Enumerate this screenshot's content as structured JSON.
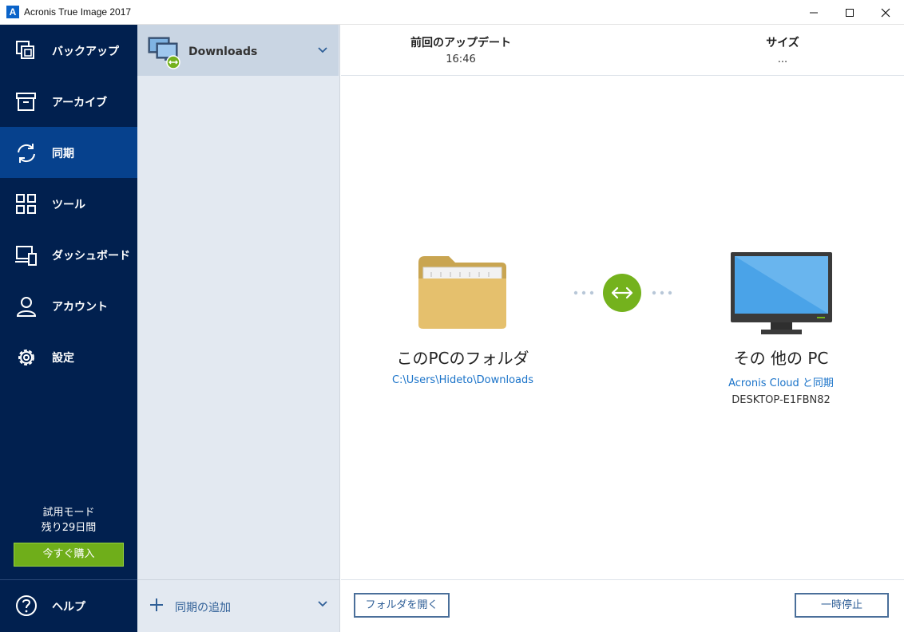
{
  "window": {
    "title": "Acronis True Image 2017",
    "logo_letter": "A"
  },
  "sidebar": {
    "items": [
      {
        "label": "バックアップ",
        "icon": "copy-icon",
        "active": false
      },
      {
        "label": "アーカイブ",
        "icon": "archive-box-icon",
        "active": false
      },
      {
        "label": "同期",
        "icon": "sync-arrows-icon",
        "active": true
      },
      {
        "label": "ツール",
        "icon": "grid-icon",
        "active": false
      },
      {
        "label": "ダッシュボード",
        "icon": "devices-icon",
        "active": false
      },
      {
        "label": "アカウント",
        "icon": "user-icon",
        "active": false
      },
      {
        "label": "設定",
        "icon": "gear-icon",
        "active": false
      }
    ],
    "trial_mode": "試用モード",
    "days_left": "残り29日間",
    "buy_now": "今すぐ購入",
    "help": "ヘルプ"
  },
  "sync_list": {
    "selected": "Downloads",
    "add_label": "同期の追加"
  },
  "info": {
    "last_update_label": "前回のアップデート",
    "last_update_value": "16:46",
    "size_label": "サイズ",
    "size_value": "..."
  },
  "local": {
    "title": "このPCのフォルダ",
    "path": "C:\\Users\\Hideto\\Downloads"
  },
  "remote": {
    "title": "その 他の PC",
    "cloud_link": "Acronis Cloud と同期",
    "device": "DESKTOP-E1FBN82"
  },
  "buttons": {
    "open_folder": "フォルダを開く",
    "pause": "一時停止"
  },
  "colors": {
    "sidebar_bg": "#01204f",
    "sidebar_active": "#06418d",
    "accent_green": "#74b21d",
    "link_blue": "#1a73c9"
  }
}
